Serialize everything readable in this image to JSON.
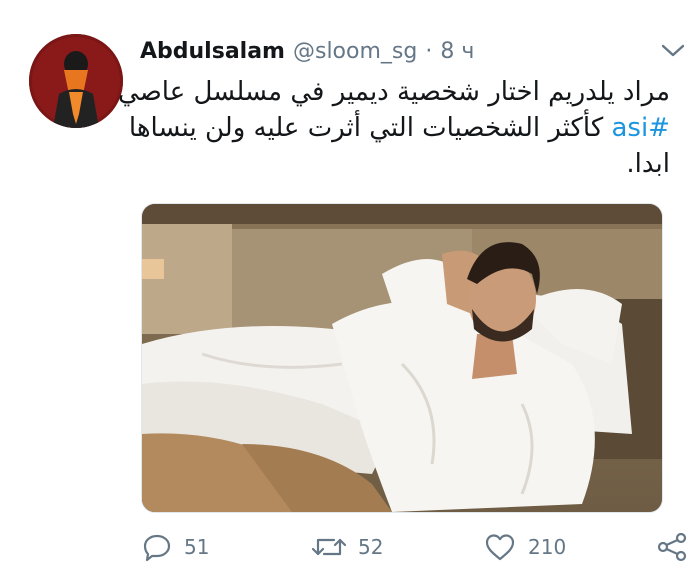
{
  "tweet": {
    "author_name": "Abdulsalam",
    "handle": "@sloom_sg",
    "separator": "·",
    "time": "8 ч",
    "text_line1": "مراد يلدريم اختار شخصية ديمير في مسلسل عاصي",
    "hashtag": "#asi",
    "text_line2_rest": " كأكثر الشخصيات التي أثرت عليه ولن ينساها",
    "text_line3": "ابدا."
  },
  "actions": {
    "replies": "51",
    "retweets": "52",
    "likes": "210"
  },
  "colors": {
    "text": "#14171a",
    "muted": "#657786",
    "link": "#1b95e0"
  }
}
